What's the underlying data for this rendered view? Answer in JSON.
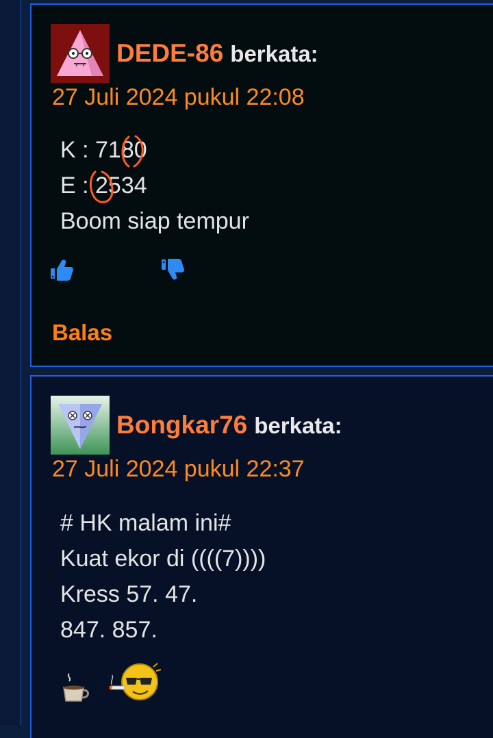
{
  "comments": [
    {
      "author": "DEDE-86",
      "says": "berkata:",
      "date": "27 Juli 2024 pukul 22:08",
      "lines": [
        "K : 7180",
        "E : 2534",
        "Boom siap tempur"
      ],
      "reply_label": "Balas"
    },
    {
      "author": "Bongkar76",
      "says": "berkata:",
      "date": "27 Juli 2024 pukul 22:37",
      "lines": [
        "# HK malam ini#",
        "Kuat ekor di ((((7))))",
        "Kress 57. 47.",
        "847. 857."
      ]
    }
  ],
  "icons": [
    "thumbs-up-icon",
    "thumbs-down-icon",
    "coffee-cup-emoji",
    "cool-smiley-emoji"
  ],
  "colors": {
    "author": "#ff7d3b",
    "date": "#ff8a1c",
    "reply": "#ff7f12",
    "border": "#1f5fe0",
    "vote": "#2d8bf3"
  }
}
